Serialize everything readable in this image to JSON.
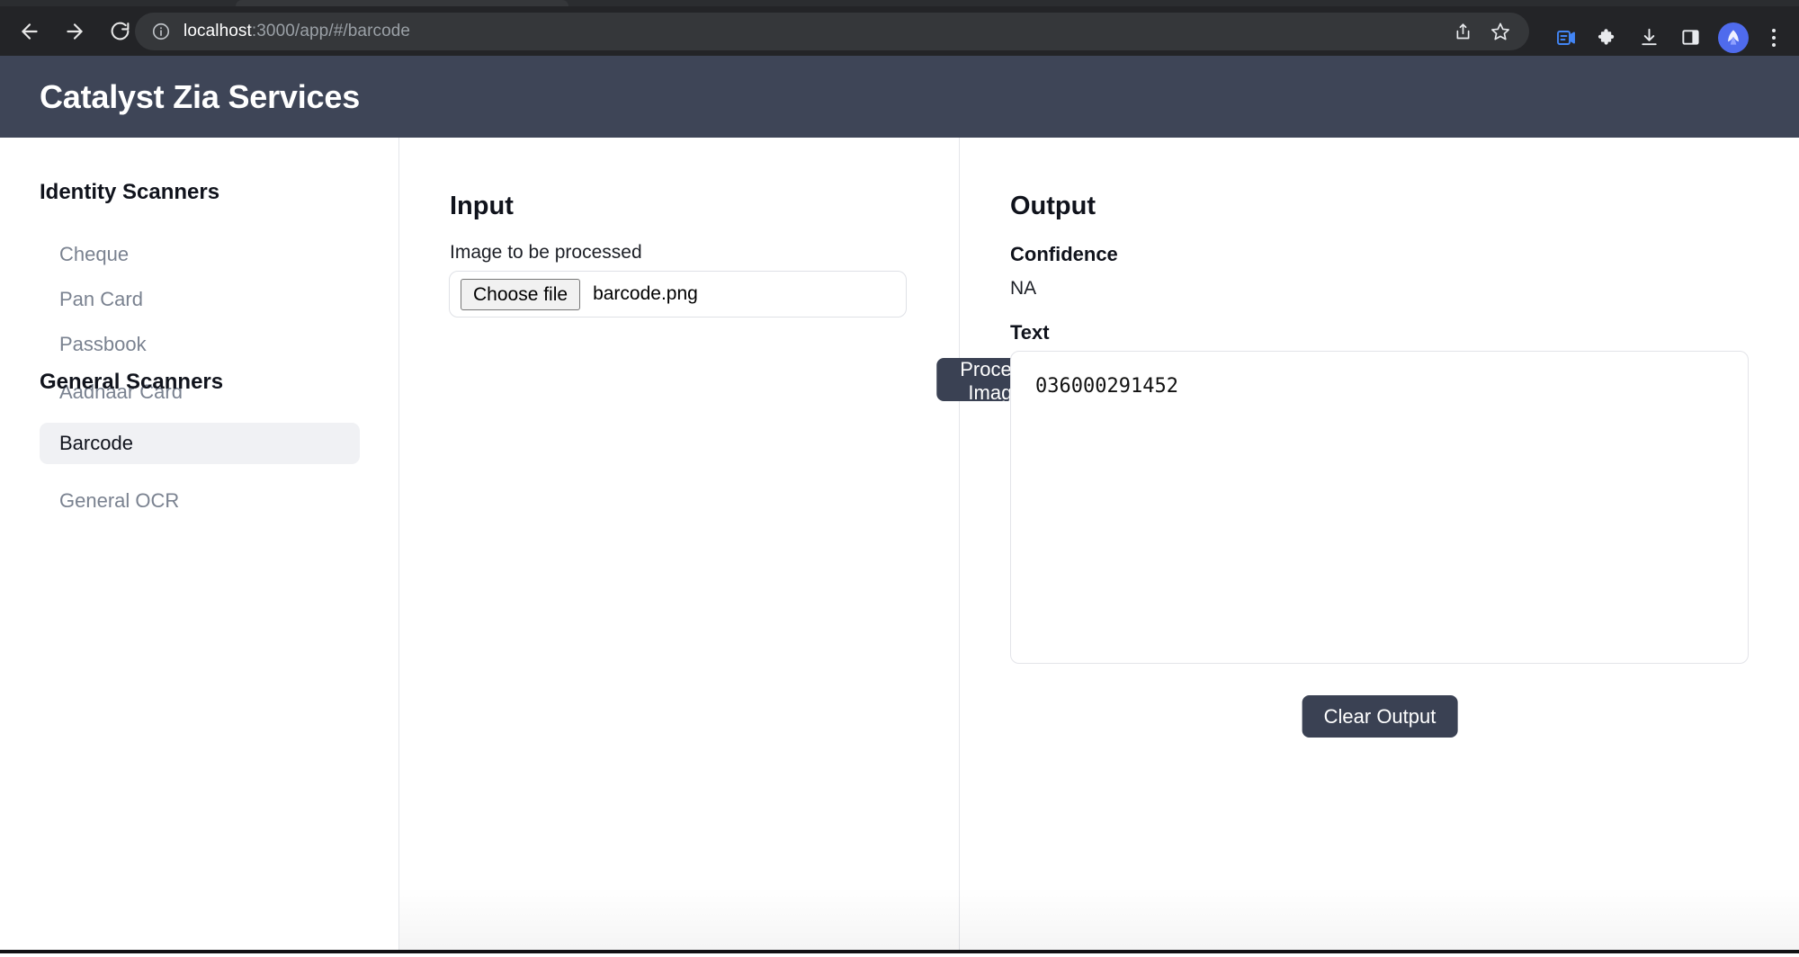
{
  "browser": {
    "url_host": "localhost",
    "url_path": ":3000/app/#/barcode",
    "back_icon": "back-arrow-icon",
    "forward_icon": "forward-arrow-icon",
    "reload_icon": "reload-icon",
    "site_info_icon": "site-info-icon",
    "share_icon": "share-icon",
    "bookmark_icon": "star-icon",
    "video_note_icon": "video-note-icon",
    "extensions_icon": "puzzle-icon",
    "downloads_icon": "download-icon",
    "side_panel_icon": "side-panel-icon",
    "profile_icon": "profile-avatar-icon",
    "menu_icon": "three-dot-menu-icon"
  },
  "header": {
    "title": "Catalyst Zia Services",
    "background": "#3e4557"
  },
  "sidebar": {
    "groups": [
      {
        "title": "Identity Scanners",
        "items": [
          {
            "label": "Cheque",
            "active": false
          },
          {
            "label": "Pan Card",
            "active": false
          },
          {
            "label": "Passbook",
            "active": false
          },
          {
            "label": "Aadhaar Card",
            "active": false
          }
        ]
      },
      {
        "title": "General Scanners",
        "items": [
          {
            "label": "Barcode",
            "active": true
          },
          {
            "label": "General OCR",
            "active": false
          }
        ]
      }
    ],
    "active_background": "#f0f1f4",
    "item_color": "#7a8290"
  },
  "input_panel": {
    "heading": "Input",
    "field_label": "Image to be processed",
    "choose_file_label": "Choose file",
    "file_name": "barcode.png",
    "process_button_label": "Process Image"
  },
  "output_panel": {
    "heading": "Output",
    "confidence_label": "Confidence",
    "confidence_value": "NA",
    "text_label": "Text",
    "text_value": "036000291452",
    "clear_button_label": "Clear Output"
  },
  "colors": {
    "accent_dark": "#3a4153",
    "chrome_dark": "#232427",
    "divider": "#e4e6ea"
  }
}
